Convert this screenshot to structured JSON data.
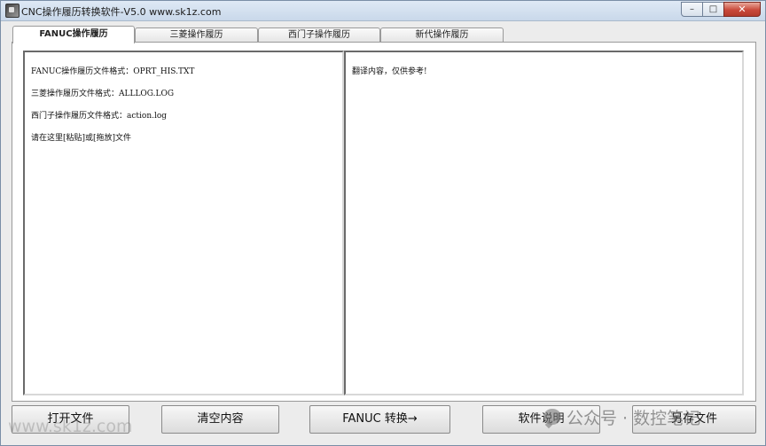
{
  "window": {
    "title": "CNC操作履历转换软件-V5.0   www.sk1z.com",
    "controls": {
      "minimize": "–",
      "maximize": "□",
      "close": "✕"
    }
  },
  "tabs": [
    {
      "label": "FANUC操作履历",
      "active": true
    },
    {
      "label": "三菱操作履历",
      "active": false
    },
    {
      "label": "西门子操作履历",
      "active": false
    },
    {
      "label": "新代操作履历",
      "active": false
    }
  ],
  "input_box": {
    "lines": [
      "FANUC操作履历文件格式：OPRT_HIS.TXT",
      "三菱操作履历文件格式：ALLLOG.LOG",
      "西门子操作履历文件格式：action.log",
      "请在这里[粘贴]或[拖放]文件"
    ]
  },
  "output_box": {
    "lines": [
      "翻译内容，仅供参考!"
    ]
  },
  "buttons": {
    "open": "打开文件",
    "clear": "清空内容",
    "convert": "FANUC 转换→",
    "help": "软件说明",
    "save": "另存文件"
  },
  "watermarks": {
    "left": "www.sk1z.com",
    "right": "公众号 · 数控笔记"
  }
}
